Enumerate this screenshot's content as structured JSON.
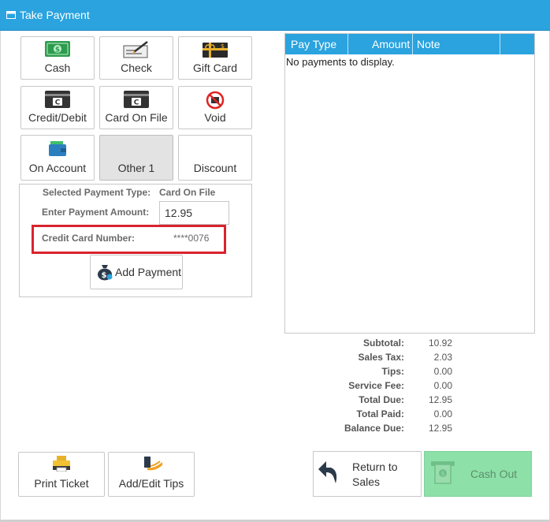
{
  "window": {
    "title": "Take Payment"
  },
  "payment_buttons": [
    {
      "label": "Cash"
    },
    {
      "label": "Check"
    },
    {
      "label": "Gift Card"
    },
    {
      "label": "Credit/Debit"
    },
    {
      "label": "Card On File"
    },
    {
      "label": "Void"
    },
    {
      "label": "On Account"
    },
    {
      "label": "Other 1",
      "selected": true
    },
    {
      "label": "Discount"
    }
  ],
  "form": {
    "selected_type_label": "Selected Payment Type:",
    "selected_type_value": "Card On File",
    "amount_label": "Enter Payment Amount:",
    "amount_value": "12.95",
    "card_label": "Credit Card Number:",
    "card_value": "****0076",
    "add_payment_label": "Add Payment"
  },
  "payments_table": {
    "columns": [
      "Pay Type",
      "Amount",
      "Note"
    ],
    "empty_message": "No payments to display."
  },
  "totals": [
    {
      "label": "Subtotal:",
      "value": "10.92"
    },
    {
      "label": "Sales Tax:",
      "value": "2.03"
    },
    {
      "label": "Tips:",
      "value": "0.00"
    },
    {
      "label": "Service Fee:",
      "value": "0.00"
    },
    {
      "label": "Total Due:",
      "value": "12.95"
    },
    {
      "label": "Total Paid:",
      "value": "0.00"
    },
    {
      "label": "Balance Due:",
      "value": "12.95"
    }
  ],
  "footer": {
    "print_ticket": "Print Ticket",
    "add_edit_tips": "Add/Edit Tips",
    "return_line1": "Return to",
    "return_line2": "Sales",
    "cash_out": "Cash Out"
  },
  "colors": {
    "header_blue": "#2aa3df",
    "highlight_red": "#d9232d",
    "cash_out_green": "#8de0a8"
  }
}
